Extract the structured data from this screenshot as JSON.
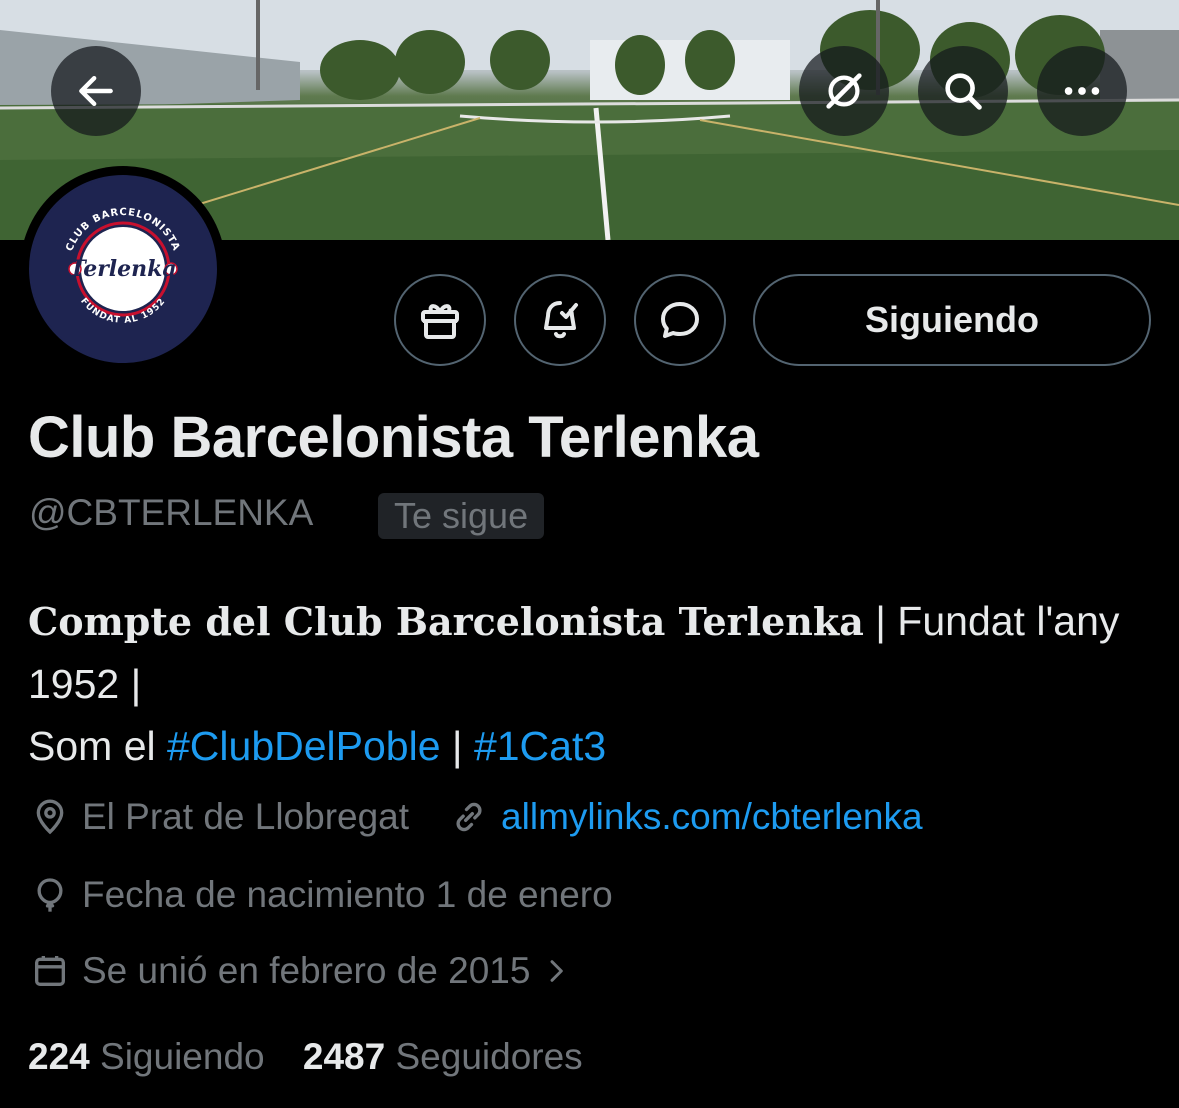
{
  "header": {
    "back_icon": "arrow-left-icon",
    "grok_icon": "grok-icon",
    "search_icon": "search-icon",
    "more_icon": "more-horizontal-icon"
  },
  "avatar": {
    "logo_top_text": "CLUB BARCELONISTA",
    "logo_center_text": "Terlenka",
    "logo_bottom_text": "FUNDAT AL 1952",
    "colors": {
      "navy": "#1e2450",
      "red": "#c8102e"
    }
  },
  "actions": {
    "gift_icon": "gift-icon",
    "notify_icon": "bell-check-icon",
    "message_icon": "message-bubble-icon",
    "follow_label": "Siguiendo"
  },
  "profile": {
    "name": "Club Barcelonista Terlenka",
    "handle": "@CBTERLENKA",
    "follows_you": "Te sigue",
    "bio": {
      "bold_part": "Compte del Club Barcelonista Terlenka",
      "part2": " | Fundat l'any 1952 |",
      "line3_prefix": "Som el ",
      "hashtag1": "#ClubDelPoble",
      "separator": " | ",
      "hashtag2": "#1Cat3"
    },
    "location": "El Prat de Llobregat",
    "website": "allmylinks.com/cbterlenka",
    "birthday": "Fecha de nacimiento 1 de enero",
    "joined": "Se unió en febrero de 2015"
  },
  "stats": {
    "following_count": "224",
    "following_label": "Siguiendo",
    "followers_count": "2487",
    "followers_label": "Seguidores"
  },
  "colors": {
    "background": "#000000",
    "text_primary": "#e7e9ea",
    "text_secondary": "#71767b",
    "accent": "#1d9bf0",
    "border": "#536471"
  }
}
